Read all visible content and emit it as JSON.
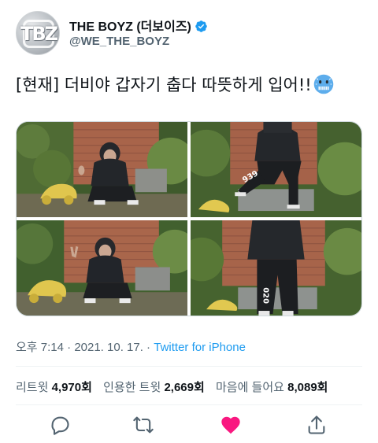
{
  "account": {
    "display_name": "THE BOYZ (더보이즈)",
    "handle": "@WE_THE_BOYZ",
    "avatar_text": "TBZ",
    "verified": true
  },
  "tweet": {
    "text": "[현재] 더비야 갑자기 춥다 따뜻하게 입어!!",
    "emoji": "cold-face-emoji"
  },
  "media": [
    {
      "name": "photo-crouching-thumbs-up"
    },
    {
      "name": "photo-standing-foot-on-tub"
    },
    {
      "name": "photo-crouching-peace-sign"
    },
    {
      "name": "photo-standing-hands-in-pockets"
    }
  ],
  "meta": {
    "time": "오후 7:14",
    "separator": " · ",
    "date": "2021. 10. 17.",
    "source": "Twitter for iPhone"
  },
  "stats": {
    "retweets_label": "리트윗",
    "retweets": "4,970",
    "retweets_unit": "회",
    "quotes_label": "인용한 트윗",
    "quotes": "2,669",
    "quotes_unit": "회",
    "likes_label": "마음에 들어요",
    "likes": "8,089",
    "likes_unit": "회"
  },
  "colors": {
    "accent": "#1d9bf0",
    "like": "#f91880",
    "secondary_text": "#536471"
  },
  "actions": [
    "reply-icon",
    "retweet-icon",
    "like-icon",
    "share-icon"
  ]
}
